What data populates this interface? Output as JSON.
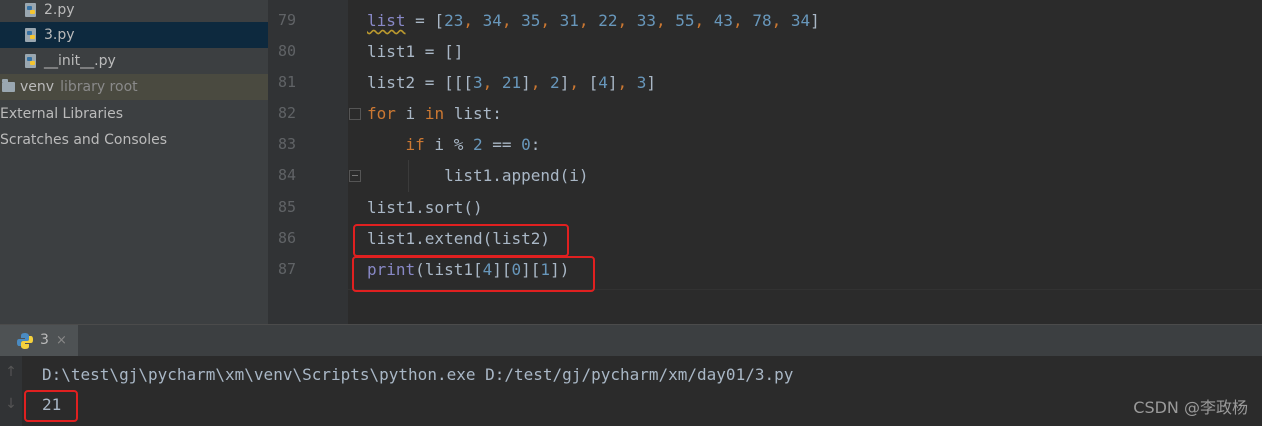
{
  "project_tree": {
    "items": [
      {
        "label": "2.py"
      },
      {
        "label": "3.py"
      },
      {
        "label": "__init__.py"
      },
      {
        "label": "venv",
        "sublabel": "library root"
      },
      {
        "label": "External Libraries"
      },
      {
        "label": "Scratches and Consoles"
      }
    ]
  },
  "editor": {
    "lines": [
      {
        "number": "79",
        "tokens": [
          {
            "t": "list",
            "c": "builtin squiggle"
          },
          {
            "t": " = ["
          },
          {
            "t": "23",
            "c": "num"
          },
          {
            "t": ", ",
            "c": "punc"
          },
          {
            "t": "34",
            "c": "num"
          },
          {
            "t": ", ",
            "c": "punc"
          },
          {
            "t": "35",
            "c": "num"
          },
          {
            "t": ", ",
            "c": "punc"
          },
          {
            "t": "31",
            "c": "num"
          },
          {
            "t": ", ",
            "c": "punc"
          },
          {
            "t": "22",
            "c": "num"
          },
          {
            "t": ", ",
            "c": "punc"
          },
          {
            "t": "33",
            "c": "num"
          },
          {
            "t": ", ",
            "c": "punc"
          },
          {
            "t": "55",
            "c": "num"
          },
          {
            "t": ", ",
            "c": "punc"
          },
          {
            "t": "43",
            "c": "num"
          },
          {
            "t": ", ",
            "c": "punc"
          },
          {
            "t": "78",
            "c": "num"
          },
          {
            "t": ", ",
            "c": "punc"
          },
          {
            "t": "34",
            "c": "num"
          },
          {
            "t": "]"
          }
        ]
      },
      {
        "number": "80",
        "tokens": [
          {
            "t": "list1 = []"
          }
        ]
      },
      {
        "number": "81",
        "tokens": [
          {
            "t": "list2 = [[["
          },
          {
            "t": "3",
            "c": "num"
          },
          {
            "t": ", ",
            "c": "punc"
          },
          {
            "t": "21",
            "c": "num"
          },
          {
            "t": "]"
          },
          {
            "t": ", ",
            "c": "punc"
          },
          {
            "t": "2",
            "c": "num"
          },
          {
            "t": "]"
          },
          {
            "t": ", ",
            "c": "punc"
          },
          {
            "t": "["
          },
          {
            "t": "4",
            "c": "num"
          },
          {
            "t": "]"
          },
          {
            "t": ", ",
            "c": "punc"
          },
          {
            "t": "3",
            "c": "num"
          },
          {
            "t": "]"
          }
        ]
      },
      {
        "number": "82",
        "tokens": [
          {
            "t": "for",
            "c": "kw"
          },
          {
            "t": " i "
          },
          {
            "t": "in",
            "c": "kw"
          },
          {
            "t": " list:"
          }
        ]
      },
      {
        "number": "83",
        "tokens": [
          {
            "t": "    "
          },
          {
            "t": "if",
            "c": "kw"
          },
          {
            "t": " i % "
          },
          {
            "t": "2",
            "c": "num"
          },
          {
            "t": " == "
          },
          {
            "t": "0",
            "c": "num"
          },
          {
            "t": ":"
          }
        ]
      },
      {
        "number": "84",
        "tokens": [
          {
            "t": "        list1.append(i)"
          }
        ]
      },
      {
        "number": "85",
        "tokens": [
          {
            "t": "list1.sort()"
          }
        ]
      },
      {
        "number": "86",
        "tokens": [
          {
            "t": "list1.extend(list2)"
          }
        ]
      },
      {
        "number": "87",
        "tokens": [
          {
            "t": "print",
            "c": "builtin"
          },
          {
            "t": "(list1["
          },
          {
            "t": "4",
            "c": "num"
          },
          {
            "t": "]["
          },
          {
            "t": "0",
            "c": "num"
          },
          {
            "t": "]["
          },
          {
            "t": "1",
            "c": "num"
          },
          {
            "t": "])"
          }
        ]
      }
    ]
  },
  "run_panel": {
    "tab_label": "3",
    "close_glyph": "×",
    "command": "D:\\test\\gj\\pycharm\\xm\\venv\\Scripts\\python.exe D:/test/gj/pycharm/xm/day01/3.py",
    "output": "21"
  },
  "watermark": "CSDN @李政杨",
  "colors": {
    "highlight_box": "#e02020",
    "selection": "#0d293e"
  }
}
